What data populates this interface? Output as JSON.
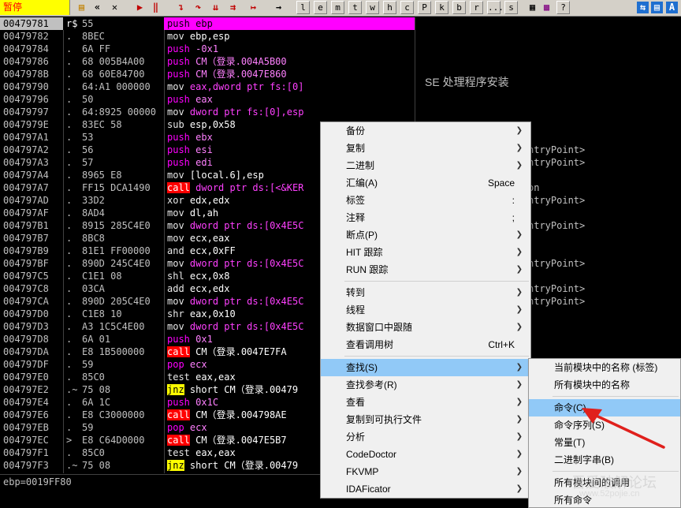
{
  "status": "暂停",
  "toolbar": {
    "letters": [
      "l",
      "e",
      "m",
      "t",
      "w",
      "h",
      "c",
      "P",
      "k",
      "b",
      "r",
      "...",
      "s"
    ],
    "question": "?"
  },
  "disasm": {
    "rows": [
      {
        "addr": "00479781",
        "mark": "r$",
        "hex": "55",
        "mn": "push",
        "ops": "ebp",
        "kind": "push",
        "sel": true
      },
      {
        "addr": "00479782",
        "mark": ".",
        "hex": "8BEC",
        "mn": "mov",
        "ops": "ebp,esp",
        "kind": "norm"
      },
      {
        "addr": "00479784",
        "mark": ".",
        "hex": "6A FF",
        "mn": "push",
        "ops": "-0x1",
        "kind": "push"
      },
      {
        "addr": "00479786",
        "mark": ".",
        "hex": "68 005B4A00",
        "mn": "push",
        "ops": "CM（登录.004A5B00",
        "kind": "push"
      },
      {
        "addr": "0047978B",
        "mark": ".",
        "hex": "68 60E84700",
        "mn": "push",
        "ops": "CM（登录.0047E860",
        "kind": "push"
      },
      {
        "addr": "00479790",
        "mark": ".",
        "hex": "64:A1 000000",
        "mn": "mov",
        "ops": "eax,dword ptr fs:[0]",
        "kind": "norm"
      },
      {
        "addr": "00479796",
        "mark": ".",
        "hex": "50",
        "mn": "push",
        "ops": "eax",
        "kind": "push"
      },
      {
        "addr": "00479797",
        "mark": ".",
        "hex": "64:8925 00000",
        "mn": "mov",
        "ops": "dword ptr fs:[0],esp",
        "kind": "norm"
      },
      {
        "addr": "0047979E",
        "mark": ".",
        "hex": "83EC 58",
        "mn": "sub",
        "ops": "esp,0x58",
        "kind": "norm"
      },
      {
        "addr": "004797A1",
        "mark": ".",
        "hex": "53",
        "mn": "push",
        "ops": "ebx",
        "kind": "push"
      },
      {
        "addr": "004797A2",
        "mark": ".",
        "hex": "56",
        "mn": "push",
        "ops": "esi",
        "kind": "push"
      },
      {
        "addr": "004797A3",
        "mark": ".",
        "hex": "57",
        "mn": "push",
        "ops": "edi",
        "kind": "push"
      },
      {
        "addr": "004797A4",
        "mark": ".",
        "hex": "8965 E8",
        "mn": "mov",
        "ops": "[local.6],esp",
        "kind": "norm"
      },
      {
        "addr": "004797A7",
        "mark": ".",
        "hex": "FF15 DCA1490",
        "mn": "call",
        "ops": "dword ptr ds:[<&KER",
        "kind": "call"
      },
      {
        "addr": "004797AD",
        "mark": ".",
        "hex": "33D2",
        "mn": "xor",
        "ops": "edx,edx",
        "kind": "norm"
      },
      {
        "addr": "004797AF",
        "mark": ".",
        "hex": "8AD4",
        "mn": "mov",
        "ops": "dl,ah",
        "kind": "norm"
      },
      {
        "addr": "004797B1",
        "mark": ".",
        "hex": "8915 285C4E0",
        "mn": "mov",
        "ops": "dword ptr ds:[0x4E5C",
        "kind": "norm"
      },
      {
        "addr": "004797B7",
        "mark": ".",
        "hex": "8BC8",
        "mn": "mov",
        "ops": "ecx,eax",
        "kind": "norm"
      },
      {
        "addr": "004797B9",
        "mark": ".",
        "hex": "81E1 FF00000",
        "mn": "and",
        "ops": "ecx,0xFF",
        "kind": "norm"
      },
      {
        "addr": "004797BF",
        "mark": ".",
        "hex": "890D 245C4E0",
        "mn": "mov",
        "ops": "dword ptr ds:[0x4E5C",
        "kind": "norm"
      },
      {
        "addr": "004797C5",
        "mark": ".",
        "hex": "C1E1 08",
        "mn": "shl",
        "ops": "ecx,0x8",
        "kind": "norm"
      },
      {
        "addr": "004797C8",
        "mark": ".",
        "hex": "03CA",
        "mn": "add",
        "ops": "ecx,edx",
        "kind": "norm"
      },
      {
        "addr": "004797CA",
        "mark": ".",
        "hex": "890D 205C4E0",
        "mn": "mov",
        "ops": "dword ptr ds:[0x4E5C",
        "kind": "norm"
      },
      {
        "addr": "004797D0",
        "mark": ".",
        "hex": "C1E8 10",
        "mn": "shr",
        "ops": "eax,0x10",
        "kind": "norm"
      },
      {
        "addr": "004797D3",
        "mark": ".",
        "hex": "A3 1C5C4E00",
        "mn": "mov",
        "ops": "dword ptr ds:[0x4E5C",
        "kind": "norm"
      },
      {
        "addr": "004797D8",
        "mark": ".",
        "hex": "6A 01",
        "mn": "push",
        "ops": "0x1",
        "kind": "push"
      },
      {
        "addr": "004797DA",
        "mark": ".",
        "hex": "E8 1B500000",
        "mn": "call",
        "ops": "CM（登录.0047E7FA",
        "kind": "call"
      },
      {
        "addr": "004797DF",
        "mark": ".",
        "hex": "59",
        "mn": "pop",
        "ops": "ecx",
        "kind": "push"
      },
      {
        "addr": "004797E0",
        "mark": ".",
        "hex": "85C0",
        "mn": "test",
        "ops": "eax,eax",
        "kind": "norm"
      },
      {
        "addr": "004797E2",
        "mark": ".~",
        "hex": "75 08",
        "mn": "jnz",
        "ops": "short CM（登录.00479",
        "kind": "jmp"
      },
      {
        "addr": "004797E4",
        "mark": ".",
        "hex": "6A 1C",
        "mn": "push",
        "ops": "0x1C",
        "kind": "push"
      },
      {
        "addr": "004797E6",
        "mark": ".",
        "hex": "E8 C3000000",
        "mn": "call",
        "ops": "CM（登录.004798AE",
        "kind": "call"
      },
      {
        "addr": "004797EB",
        "mark": ".",
        "hex": "59",
        "mn": "pop",
        "ops": "ecx",
        "kind": "push"
      },
      {
        "addr": "004797EC",
        "mark": ">",
        "hex": "E8 C64D0000",
        "mn": "call",
        "ops": "CM（登录.0047E5B7",
        "kind": "call"
      },
      {
        "addr": "004797F1",
        "mark": ".",
        "hex": "85C0",
        "mn": "test",
        "ops": "eax,eax",
        "kind": "norm"
      },
      {
        "addr": "004797F3",
        "mark": ".~",
        "hex": "75 08",
        "mn": "jnz",
        "ops": "short CM（登录.00479",
        "kind": "jmp"
      }
    ],
    "comments": [
      {
        "row": 4,
        "text": "SE 处理程序安装"
      },
      {
        "row": 10,
        "text": "ntryPoint>"
      },
      {
        "row": 11,
        "text": "ntryPoint>"
      },
      {
        "row": 13,
        "text": "on"
      },
      {
        "row": 14,
        "text": "ntryPoint>"
      },
      {
        "row": 16,
        "text": "ntryPoint>"
      },
      {
        "row": 19,
        "text": "ntryPoint>"
      },
      {
        "row": 21,
        "text": "ntryPoint>"
      },
      {
        "row": 22,
        "text": "ntryPoint>"
      }
    ]
  },
  "info_bar": "ebp=0019FF80",
  "context_menu": {
    "items": [
      {
        "label": "备份",
        "shortcut": "",
        "submenu": true
      },
      {
        "label": "复制",
        "shortcut": "",
        "submenu": true
      },
      {
        "label": "二进制",
        "shortcut": "",
        "submenu": true
      },
      {
        "label": "汇编(A)",
        "shortcut": "Space",
        "submenu": false
      },
      {
        "label": "标签",
        "shortcut": ":",
        "submenu": false
      },
      {
        "label": "注释",
        "shortcut": ";",
        "submenu": false
      },
      {
        "label": "断点(P)",
        "shortcut": "",
        "submenu": true
      },
      {
        "label": "HIT 跟踪",
        "shortcut": "",
        "submenu": true
      },
      {
        "label": "RUN 跟踪",
        "shortcut": "",
        "submenu": true
      },
      {
        "sep": true
      },
      {
        "label": "转到",
        "shortcut": "",
        "submenu": true
      },
      {
        "label": "线程",
        "shortcut": "",
        "submenu": true
      },
      {
        "label": "数据窗口中跟随",
        "shortcut": "",
        "submenu": true
      },
      {
        "label": "查看调用树",
        "shortcut": "Ctrl+K",
        "submenu": false
      },
      {
        "sep": true
      },
      {
        "label": "查找(S)",
        "shortcut": "",
        "submenu": true,
        "hl": true
      },
      {
        "label": "查找参考(R)",
        "shortcut": "",
        "submenu": true
      },
      {
        "label": "查看",
        "shortcut": "",
        "submenu": true
      },
      {
        "label": "复制到可执行文件",
        "shortcut": "",
        "submenu": true
      },
      {
        "label": "分析",
        "shortcut": "",
        "submenu": true
      },
      {
        "label": "CodeDoctor",
        "shortcut": "",
        "submenu": true
      },
      {
        "label": "FKVMP",
        "shortcut": "",
        "submenu": true
      },
      {
        "label": "IDAFicator",
        "shortcut": "",
        "submenu": true
      }
    ]
  },
  "submenu": {
    "items": [
      {
        "label": "当前模块中的名称 (标签)"
      },
      {
        "label": "所有模块中的名称"
      },
      {
        "sep": true
      },
      {
        "label": "命令(C)",
        "hl": true
      },
      {
        "label": "命令序列(S)"
      },
      {
        "label": "常量(T)"
      },
      {
        "label": "二进制字串(B)"
      },
      {
        "sep": true
      },
      {
        "label": "所有模块间的调用"
      },
      {
        "label": "所有命令"
      }
    ]
  },
  "watermark": "吾爱破解论坛",
  "watermark_url": "www.52pojie.cn",
  "colors": {
    "push": "#ff00ff",
    "call_bg": "#ff0000",
    "jmp_bg": "#ffff00",
    "menu_highlight": "#91c9f7",
    "annotation_arrow": "#e0201c"
  }
}
